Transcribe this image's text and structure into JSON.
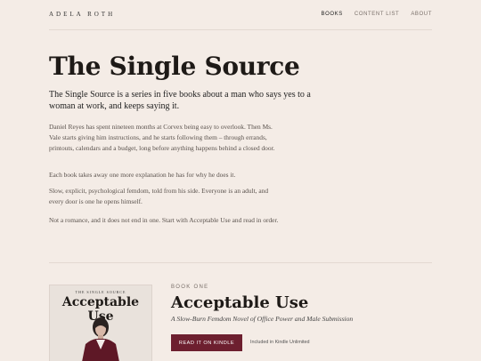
{
  "header": {
    "brand": "ADELA ROTH",
    "nav": [
      {
        "label": "BOOKS",
        "active": true
      },
      {
        "label": "CONTENT LIST",
        "active": false
      },
      {
        "label": "ABOUT",
        "active": false
      }
    ]
  },
  "intro": {
    "title": "The Single Source",
    "lead": "The Single Source is a series in five books about a man who says yes to a woman at work, and keeps saying it.",
    "paragraphs": [
      "Daniel Reyes has spent nineteen months at Corvex being easy to overlook. Then Ms. Vale starts giving him instructions, and he starts following them – through errands, printouts, calendars and a budget, long before anything happens behind a closed door.",
      "Each book takes away one more explanation he has for why he does it.",
      "Slow, explicit, psychological femdom, told from his side. Everyone is an adult, and every door is one he opens himself.",
      "Not a romance, and it does not end in one. Start with Acceptable Use and read in order."
    ]
  },
  "book": {
    "label": "BOOK ONE",
    "title": "Acceptable Use",
    "subtitle": "A Slow-Burn Femdom Novel of Office Power and Male Submission",
    "button": "READ IT ON KINDLE",
    "note": "Included in Kindle Unlimited",
    "cover": {
      "series": "THE SINGLE SOURCE",
      "title": "Acceptable Use"
    }
  },
  "colors": {
    "background": "#f4ece6",
    "accent": "#6d1f2f"
  }
}
